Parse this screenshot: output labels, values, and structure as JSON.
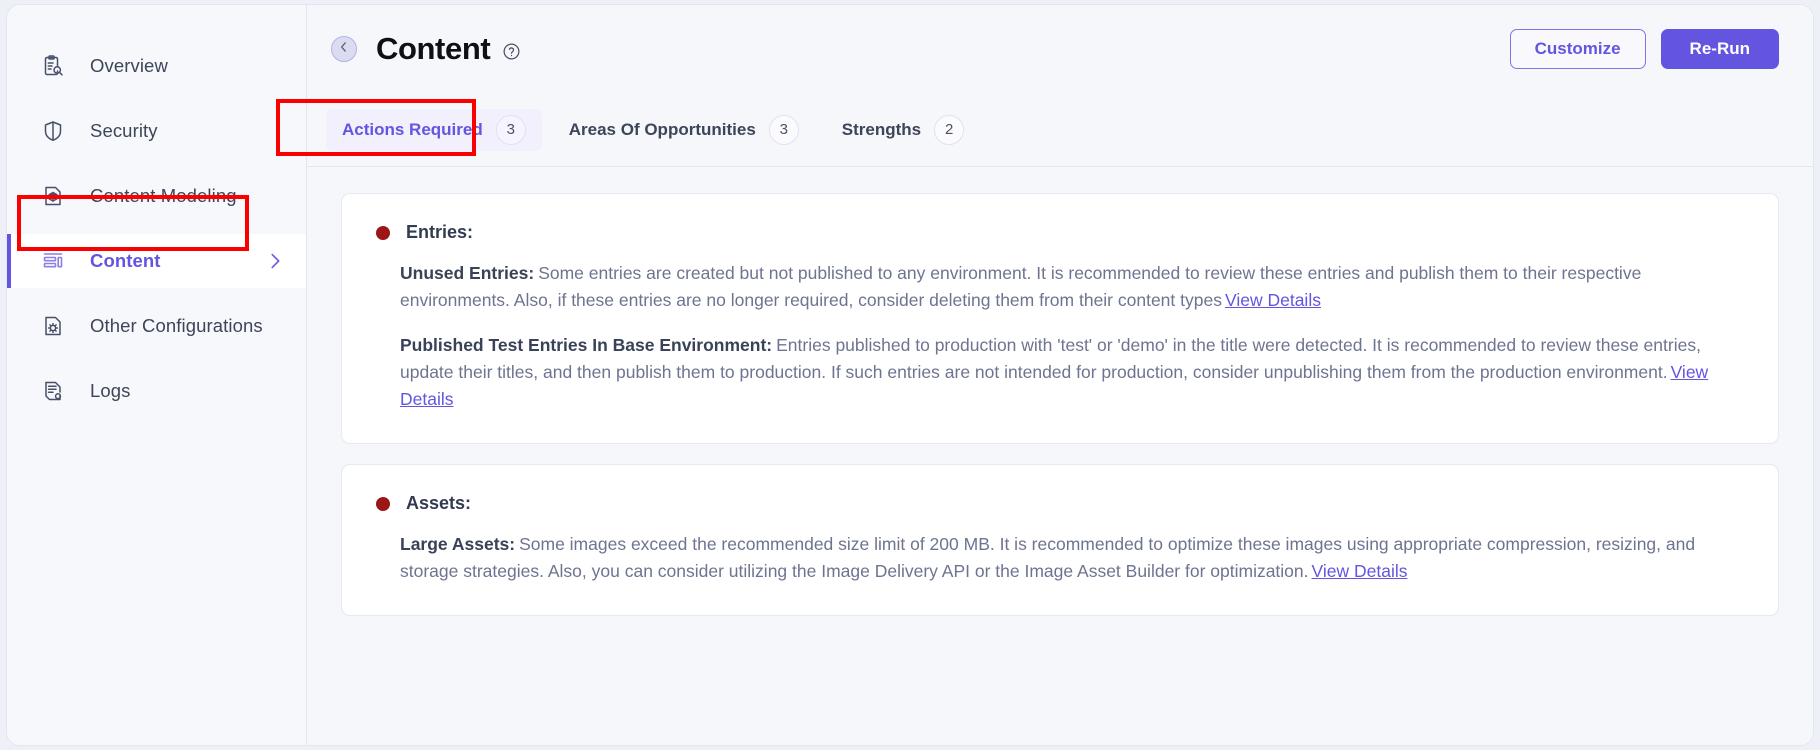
{
  "sidebar": {
    "items": [
      {
        "label": "Overview",
        "icon": "clipboard-search-icon",
        "active": false
      },
      {
        "label": "Security",
        "icon": "shield-icon",
        "active": false
      },
      {
        "label": "Content Modeling",
        "icon": "document-cube-icon",
        "active": false
      },
      {
        "label": "Content",
        "icon": "content-list-icon",
        "active": true
      },
      {
        "label": "Other Configurations",
        "icon": "document-gear-icon",
        "active": false
      },
      {
        "label": "Logs",
        "icon": "document-log-icon",
        "active": false
      }
    ]
  },
  "header": {
    "back_icon": "chevron-left-icon",
    "title": "Content",
    "help_icon": "question-circle-icon",
    "customize_label": "Customize",
    "rerun_label": "Re-Run"
  },
  "tabs": [
    {
      "label": "Actions Required",
      "count": "3",
      "active": true
    },
    {
      "label": "Areas Of Opportunities",
      "count": "3",
      "active": false
    },
    {
      "label": "Strengths",
      "count": "2",
      "active": false
    }
  ],
  "cards": [
    {
      "title": "Entries:",
      "severity_color": "#9d1616",
      "findings": [
        {
          "label": "Unused Entries:",
          "text": "Some entries are created but not published to any environment. It is recommended to review these entries and publish them to their respective environments. Also, if these entries are no longer required, consider deleting them from their content types",
          "link": "View Details"
        },
        {
          "label": "Published Test Entries In Base Environment:",
          "text": "Entries published to production with 'test' or 'demo' in the title were detected. It is recommended to review these entries, update their titles, and then publish them to production. If such entries are not intended for production, consider unpublishing them from the production environment.",
          "link": "View Details"
        }
      ]
    },
    {
      "title": "Assets:",
      "severity_color": "#9d1616",
      "findings": [
        {
          "label": "Large Assets:",
          "text": "Some images exceed the recommended size limit of 200 MB. It is recommended to optimize these images using appropriate compression, resizing, and storage strategies. Also, you can consider utilizing the Image Delivery API or the Image Asset Builder for optimization.",
          "link": "View Details"
        }
      ]
    }
  ],
  "colors": {
    "accent": "#6355e0",
    "annotation": "#fb0000",
    "page_bg": "#f6f7fb",
    "card_bg": "#ffffff"
  }
}
